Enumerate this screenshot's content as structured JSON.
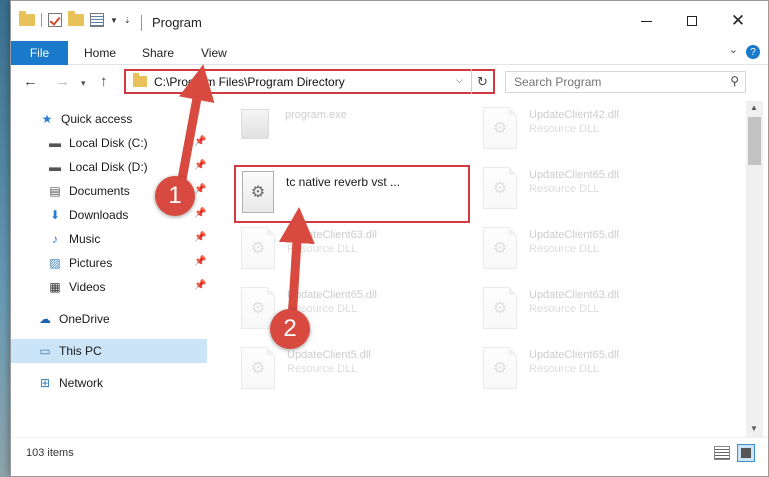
{
  "window": {
    "title": "Program",
    "controls": {
      "minimize": "",
      "maximize": "",
      "close": "✕"
    }
  },
  "ribbon": {
    "tabs": [
      {
        "label": "File",
        "active": true
      },
      {
        "label": "Home"
      },
      {
        "label": "Share"
      },
      {
        "label": "View"
      }
    ],
    "help": "?"
  },
  "address": {
    "path": "C:\\Program Files\\Program Directory",
    "search_placeholder": "Search Program"
  },
  "nav_pane": {
    "items": [
      {
        "label": "Quick access",
        "icon": "star-icon",
        "pinned": false
      },
      {
        "label": "Local Disk (C:)",
        "icon": "disk-icon",
        "pinned": true
      },
      {
        "label": "Local Disk (D:)",
        "icon": "disk-icon",
        "pinned": true
      },
      {
        "label": "Documents",
        "icon": "documents-icon",
        "pinned": true
      },
      {
        "label": "Downloads",
        "icon": "downloads-icon",
        "pinned": true
      },
      {
        "label": "Music",
        "icon": "music-icon",
        "pinned": true
      },
      {
        "label": "Pictures",
        "icon": "pictures-icon",
        "pinned": true
      },
      {
        "label": "Videos",
        "icon": "videos-icon",
        "pinned": true
      },
      {
        "label": "OneDrive",
        "icon": "onedrive-icon",
        "pinned": false
      },
      {
        "label": "This PC",
        "icon": "pc-icon",
        "pinned": false,
        "selected": true
      },
      {
        "label": "Network",
        "icon": "network-icon",
        "pinned": false
      }
    ]
  },
  "files": [
    {
      "name": "program.exe",
      "type": "",
      "icon": "exe-icon"
    },
    {
      "name": "UpdateClient42.dll",
      "type": "Resource DLL",
      "icon": "dll-icon"
    },
    {
      "name": "tc native reverb vst ...",
      "type": "",
      "icon": "dll-icon",
      "highlighted": true
    },
    {
      "name": "UpdateClient65.dll",
      "type": "Resource DLL",
      "icon": "dll-icon"
    },
    {
      "name": "UpdateClient63.dll",
      "type": "Resource DLL",
      "icon": "dll-icon"
    },
    {
      "name": "UpdateClient65.dll",
      "type": "Resource DLL",
      "icon": "dll-icon"
    },
    {
      "name": "UpdateClient65.dll",
      "type": "Resource DLL",
      "icon": "dll-icon"
    },
    {
      "name": "UpdateClient63.dll",
      "type": "Resource DLL",
      "icon": "dll-icon"
    },
    {
      "name": "UpdateClient5.dll",
      "type": "Resource DLL",
      "icon": "dll-icon"
    },
    {
      "name": "UpdateClient65.dll",
      "type": "Resource DLL",
      "icon": "dll-icon"
    }
  ],
  "status": {
    "item_count": "103 items"
  },
  "annotations": {
    "step1": "1",
    "step2": "2",
    "color": "#d84a3f"
  }
}
